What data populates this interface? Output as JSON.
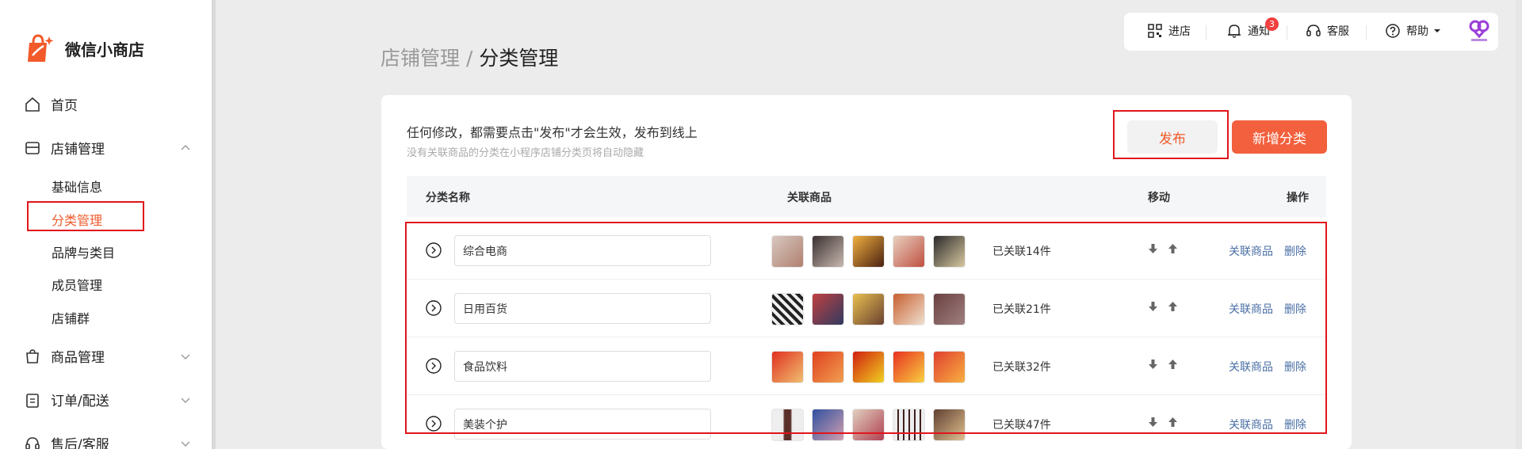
{
  "app": {
    "name": "微信小商店"
  },
  "sidebar": {
    "items": [
      {
        "label": "首页"
      },
      {
        "label": "店铺管理"
      },
      {
        "label": "商品管理"
      },
      {
        "label": "订单/配送"
      },
      {
        "label": "售后/客服"
      }
    ],
    "sub_items": [
      {
        "label": "基础信息"
      },
      {
        "label": "分类管理"
      },
      {
        "label": "品牌与类目"
      },
      {
        "label": "成员管理"
      },
      {
        "label": "店铺群"
      }
    ]
  },
  "topbar": {
    "enter_store": "进店",
    "notify": "通知",
    "notify_count": "3",
    "service": "客服",
    "help": "帮助"
  },
  "breadcrumb": {
    "parent": "店铺管理",
    "sep": " / ",
    "current": "分类管理"
  },
  "card": {
    "notice": "任何修改，都需要点击\"发布\"才会生效，发布到线上",
    "subnotice": "没有关联商品的分类在小程序店铺分类页将自动隐藏",
    "publish_label": "发布",
    "add_label": "新增分类"
  },
  "table": {
    "headers": {
      "name": "分类名称",
      "products": "关联商品",
      "move": "移动",
      "ops": "操作"
    },
    "rows": [
      {
        "name": "综合电商",
        "count": "已关联14件"
      },
      {
        "name": "日用百货",
        "count": "已关联21件"
      },
      {
        "name": "食品饮料",
        "count": "已关联32件"
      },
      {
        "name": "美装个护",
        "count": "已关联47件"
      }
    ],
    "link_related": "关联商品",
    "link_delete": "删除"
  },
  "colors": {
    "accent": "#f05a2a",
    "primary_button": "#f2603d",
    "link": "#4a6fa5",
    "highlight_box": "#e0161b"
  }
}
